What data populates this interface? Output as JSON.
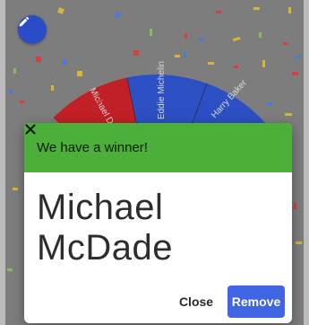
{
  "wheel": {
    "segments": [
      {
        "label": "Michael Dunleavy",
        "color": "#c02026"
      },
      {
        "label": "Eddie Michelin",
        "color": "#2c4fc4"
      },
      {
        "label": "Harry Baker",
        "color": "#2c4fc4"
      }
    ]
  },
  "edit_button": {
    "icon": "pencil-icon"
  },
  "dialog": {
    "title": "We have a winner!",
    "close_icon": "close-icon",
    "winner_name": "Michael McDade",
    "close_label": "Close",
    "remove_label": "Remove"
  },
  "colors": {
    "overlay": "#7d7d7d",
    "header_green": "#4caf3a",
    "primary_blue": "#3f65e3",
    "fab_blue": "#2a4cc9",
    "wheel_red": "#c02026"
  }
}
